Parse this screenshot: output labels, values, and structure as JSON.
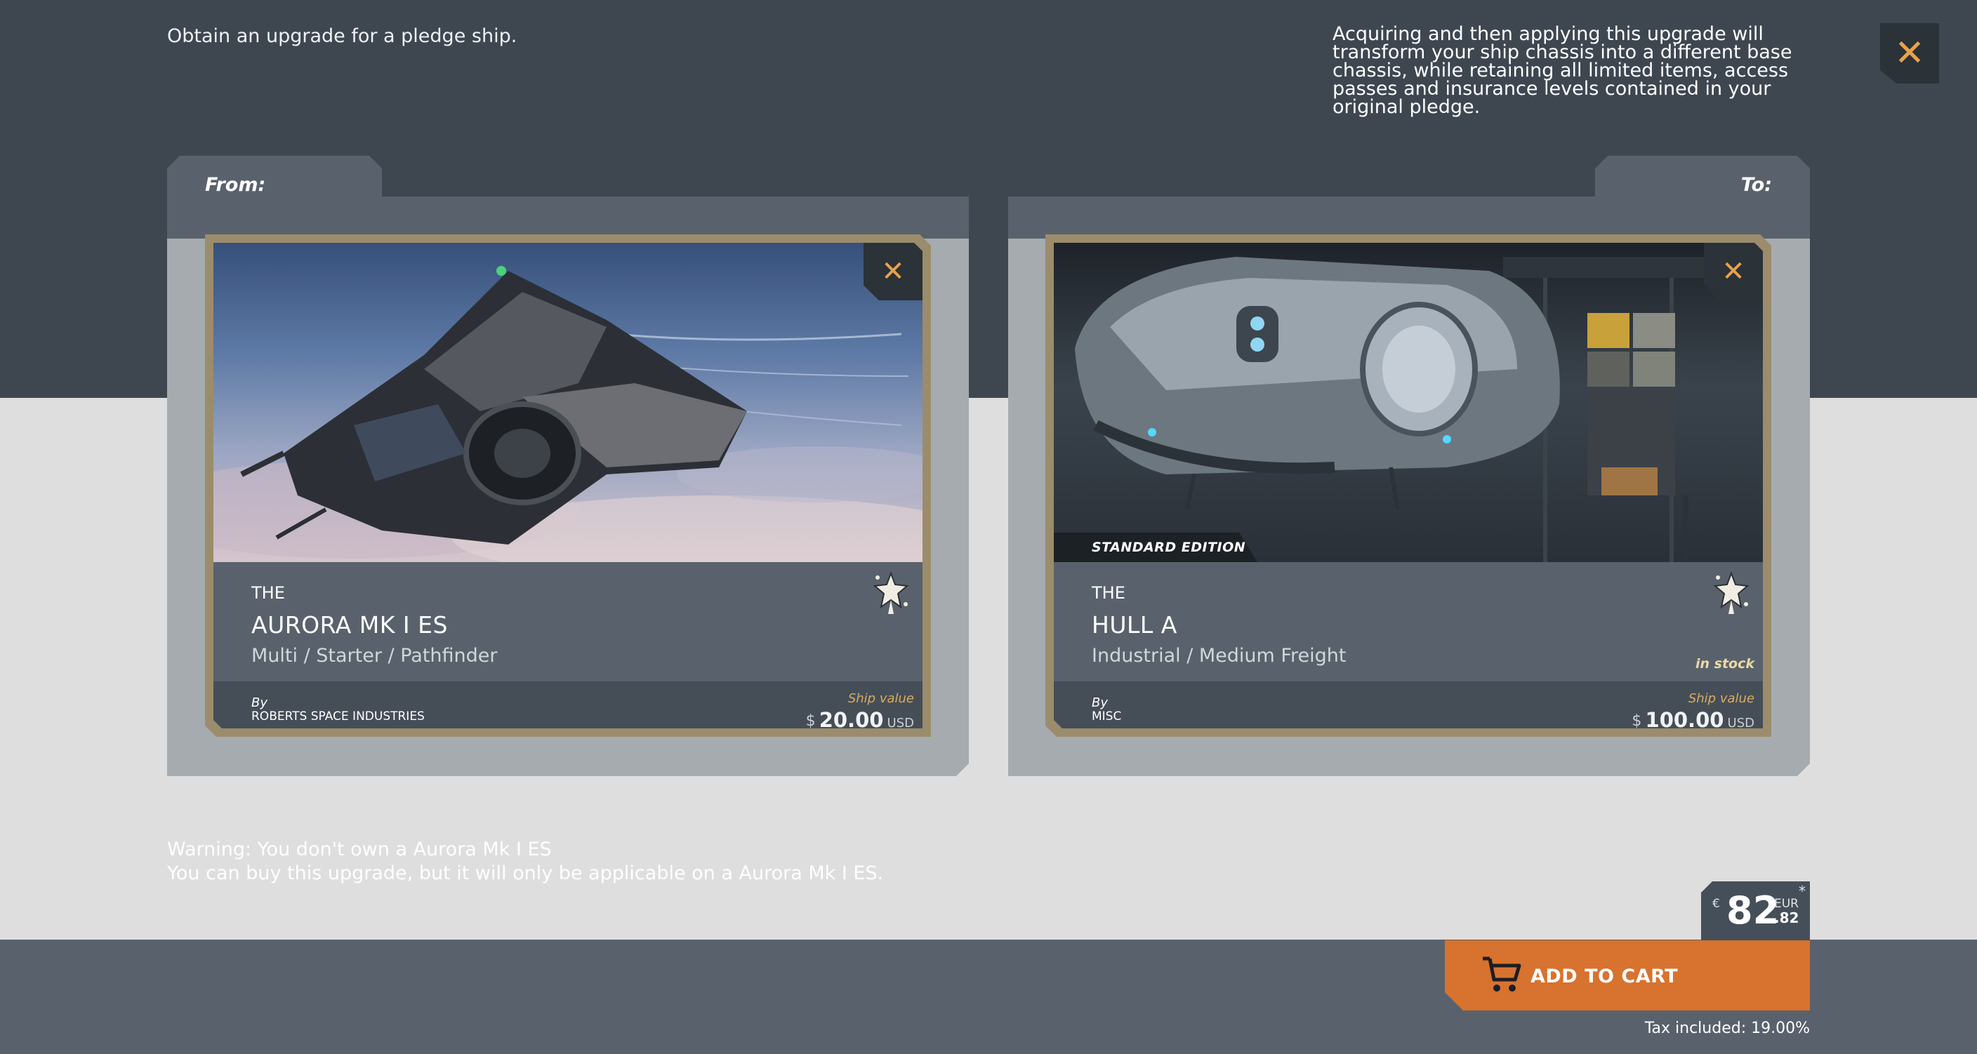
{
  "header": {
    "intro": "Obtain an upgrade for a pledge ship.",
    "description": "Acquiring and then applying this upgrade will transform your ship chassis into a different base chassis, while retaining all limited items, access passes and insurance levels contained in your original pledge."
  },
  "from": {
    "tab_label": "From:",
    "the": "THE",
    "name": "AURORA MK I ES",
    "focus": "Multi / Starter / Pathfinder",
    "by_label": "By",
    "manufacturer": "ROBERTS SPACE INDUSTRIES",
    "value_label": "Ship value",
    "currency_symbol": "$",
    "value": "20.00",
    "currency_code": "USD"
  },
  "to": {
    "tab_label": "To:",
    "edition": "STANDARD EDITION",
    "the": "THE",
    "name": "HULL A",
    "focus": "Industrial / Medium Freight",
    "stock": "in stock",
    "by_label": "By",
    "manufacturer": "MISC",
    "value_label": "Ship value",
    "currency_symbol": "$",
    "value": "100.00",
    "currency_code": "USD"
  },
  "warning": {
    "line1": "Warning: You don't own a Aurora Mk I ES",
    "line2": "You can buy this upgrade, but it will only be applicable on a Aurora Mk I ES."
  },
  "total": {
    "currency_symbol": "€",
    "integer": "82",
    "currency_code": "EUR",
    "decimal": ".82",
    "asterisk": "*"
  },
  "cart": {
    "label": "ADD TO CART",
    "tax": "Tax included: 19.00%"
  },
  "icons": {
    "close": "close-icon",
    "logo": "manufacturer-logo-icon",
    "cart": "cart-icon"
  },
  "colors": {
    "accent": "#d8722f",
    "close_x": "#e8a24b",
    "card_border": "#9b8c6c",
    "stock": "#ecd8a5",
    "value_label": "#dbaa5d"
  }
}
